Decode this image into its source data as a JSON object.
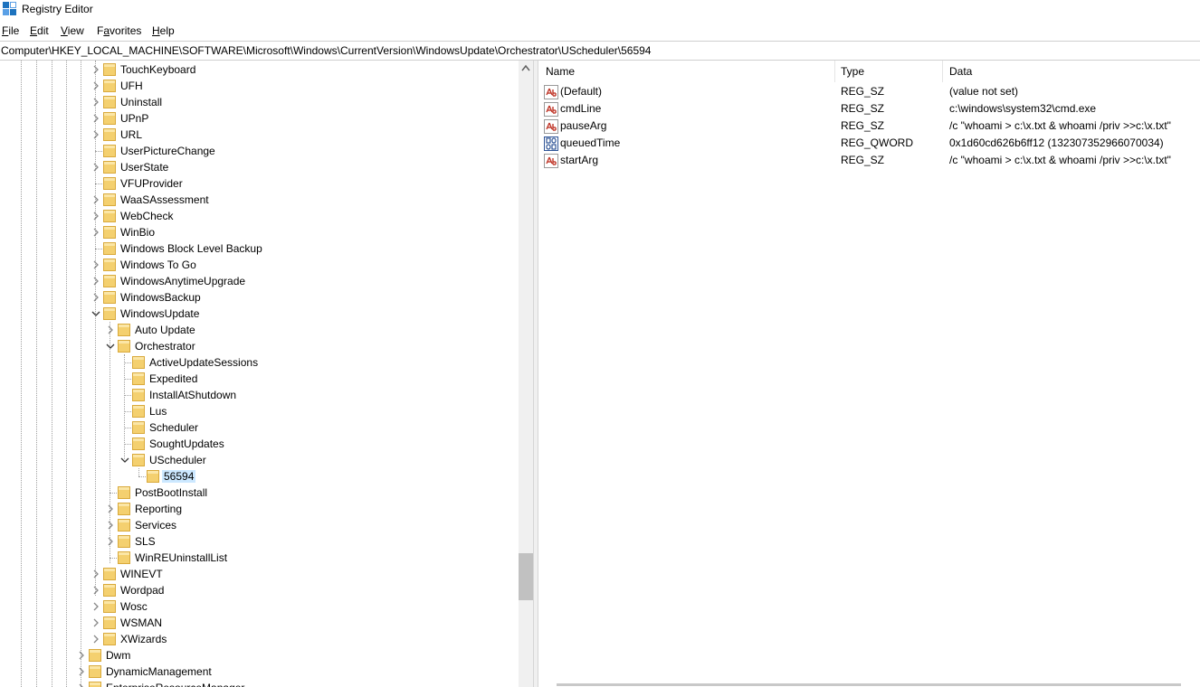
{
  "window": {
    "title": "Registry Editor"
  },
  "menu": [
    {
      "accel": "F",
      "rest": "ile"
    },
    {
      "accel": "E",
      "rest": "dit"
    },
    {
      "accel": "V",
      "rest": "iew"
    },
    {
      "pre": "F",
      "accel": "a",
      "rest": "vorites"
    },
    {
      "accel": "H",
      "rest": "elp"
    }
  ],
  "address": {
    "path": "Computer\\HKEY_LOCAL_MACHINE\\SOFTWARE\\Microsoft\\Windows\\CurrentVersion\\WindowsUpdate\\Orchestrator\\UScheduler\\56594"
  },
  "tree": [
    {
      "label": "TouchKeyboard",
      "level": 3,
      "exp": "collapsed"
    },
    {
      "label": "UFH",
      "level": 3,
      "exp": "collapsed"
    },
    {
      "label": "Uninstall",
      "level": 3,
      "exp": "collapsed"
    },
    {
      "label": "UPnP",
      "level": 3,
      "exp": "collapsed"
    },
    {
      "label": "URL",
      "level": 3,
      "exp": "collapsed"
    },
    {
      "label": "UserPictureChange",
      "level": 3,
      "exp": "none"
    },
    {
      "label": "UserState",
      "level": 3,
      "exp": "collapsed"
    },
    {
      "label": "VFUProvider",
      "level": 3,
      "exp": "none"
    },
    {
      "label": "WaaSAssessment",
      "level": 3,
      "exp": "collapsed"
    },
    {
      "label": "WebCheck",
      "level": 3,
      "exp": "collapsed"
    },
    {
      "label": "WinBio",
      "level": 3,
      "exp": "collapsed"
    },
    {
      "label": "Windows Block Level Backup",
      "level": 3,
      "exp": "none"
    },
    {
      "label": "Windows To Go",
      "level": 3,
      "exp": "collapsed"
    },
    {
      "label": "WindowsAnytimeUpgrade",
      "level": 3,
      "exp": "collapsed"
    },
    {
      "label": "WindowsBackup",
      "level": 3,
      "exp": "collapsed"
    },
    {
      "label": "WindowsUpdate",
      "level": 3,
      "exp": "expanded"
    },
    {
      "label": "Auto Update",
      "level": 4,
      "exp": "collapsed"
    },
    {
      "label": "Orchestrator",
      "level": 4,
      "exp": "expanded"
    },
    {
      "label": "ActiveUpdateSessions",
      "level": 5,
      "exp": "none"
    },
    {
      "label": "Expedited",
      "level": 5,
      "exp": "none"
    },
    {
      "label": "InstallAtShutdown",
      "level": 5,
      "exp": "none"
    },
    {
      "label": "Lus",
      "level": 5,
      "exp": "none"
    },
    {
      "label": "Scheduler",
      "level": 5,
      "exp": "none"
    },
    {
      "label": "SoughtUpdates",
      "level": 5,
      "exp": "none"
    },
    {
      "label": "UScheduler",
      "level": 5,
      "exp": "expanded"
    },
    {
      "label": "56594",
      "level": 6,
      "exp": "none",
      "selected": true
    },
    {
      "label": "PostBootInstall",
      "level": 4,
      "exp": "none"
    },
    {
      "label": "Reporting",
      "level": 4,
      "exp": "collapsed"
    },
    {
      "label": "Services",
      "level": 4,
      "exp": "collapsed"
    },
    {
      "label": "SLS",
      "level": 4,
      "exp": "collapsed"
    },
    {
      "label": "WinREUninstallList",
      "level": 4,
      "exp": "none"
    },
    {
      "label": "WINEVT",
      "level": 3,
      "exp": "collapsed"
    },
    {
      "label": "Wordpad",
      "level": 3,
      "exp": "collapsed"
    },
    {
      "label": "Wosc",
      "level": 3,
      "exp": "collapsed"
    },
    {
      "label": "WSMAN",
      "level": 3,
      "exp": "collapsed"
    },
    {
      "label": "XWizards",
      "level": 3,
      "exp": "collapsed"
    },
    {
      "label": "Dwm",
      "level": 2,
      "exp": "collapsed"
    },
    {
      "label": "DynamicManagement",
      "level": 2,
      "exp": "collapsed"
    },
    {
      "label": "EnterpriseResourceManager",
      "level": 2,
      "exp": "collapsed"
    }
  ],
  "values": {
    "columns": {
      "name": "Name",
      "type": "Type",
      "data": "Data"
    },
    "rows": [
      {
        "name": "(Default)",
        "type": "REG_SZ",
        "data": "(value not set)",
        "icon": "string-value-icon"
      },
      {
        "name": "cmdLine",
        "type": "REG_SZ",
        "data": "c:\\windows\\system32\\cmd.exe",
        "icon": "string-value-icon"
      },
      {
        "name": "pauseArg",
        "type": "REG_SZ",
        "data": "/c \"whoami > c:\\x.txt & whoami /priv >>c:\\x.txt\"",
        "icon": "string-value-icon"
      },
      {
        "name": "queuedTime",
        "type": "REG_QWORD",
        "data": "0x1d60cd626b6ff12 (132307352966070034)",
        "icon": "binary-value-icon"
      },
      {
        "name": "startArg",
        "type": "REG_SZ",
        "data": "/c \"whoami > c:\\x.txt & whoami /priv >>c:\\x.txt\"",
        "icon": "string-value-icon"
      }
    ]
  },
  "colors": {
    "folder": "#f4d06f",
    "selection": "#cce8ff",
    "string_icon": "#c0392b",
    "binary_icon": "#2f5597"
  }
}
